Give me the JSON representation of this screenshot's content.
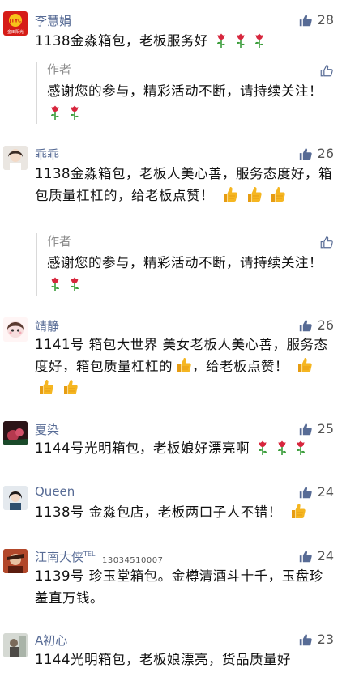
{
  "comments": [
    {
      "name": "李慧娟",
      "likes": "28",
      "avatar_text_top": "JTYC",
      "avatar_text_bottom": "金田阳光",
      "text": "1138金淼箱包，老板服务好",
      "reply": {
        "name": "作者",
        "text": "感谢您的参与，精彩活动不断，请持续关注！"
      }
    },
    {
      "name": "乖乖",
      "likes": "26",
      "text": "1138金淼箱包，老板人美心善，服务态度好，箱包质量杠杠的，给老板点赞！",
      "reply": {
        "name": "作者",
        "text": "感谢您的参与，精彩活动不断，请持续关注！"
      }
    },
    {
      "name": "靖静",
      "likes": "26",
      "text_a": "1141号  箱包大世界   美女老板人美心善，服务态度好，箱包质量杠杠的",
      "text_b": "，给老板点赞！"
    },
    {
      "name": "夏染",
      "likes": "25",
      "text": "1144号光明箱包，老板娘好漂亮啊"
    },
    {
      "name": "Queen",
      "likes": "24",
      "text": "1138号 金淼包店，老板两口子人不错！"
    },
    {
      "name": "江南大侠",
      "name_suffix": "TEL",
      "phone": "13034510007",
      "likes": "24",
      "text": "1139号 珍玉堂箱包。金樽清酒斗十千，玉盘珍羞直万钱。"
    },
    {
      "name": "A初心",
      "likes": "23",
      "text": "1144光明箱包，老板娘漂亮，货品质量好"
    }
  ],
  "colors": {
    "name": "#576b95",
    "rose_petal": "#d7263d",
    "rose_leaf": "#3a9d3a",
    "thumb": "#f5b621",
    "like_icon": "#576b95"
  },
  "icons": {
    "like": "thumbs-up-icon",
    "rose": "rose-emoji",
    "thumbs": "thumbs-up-emoji"
  }
}
